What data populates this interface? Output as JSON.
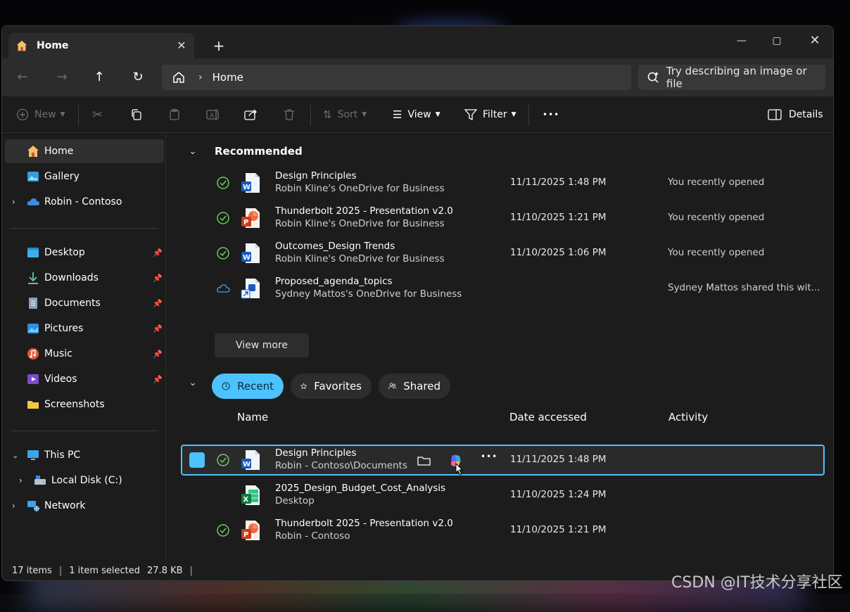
{
  "window": {
    "tab_title": "Home",
    "new_tab_label": "+"
  },
  "address": {
    "current": "Home",
    "search_placeholder": "Try describing an image or file"
  },
  "toolbar": {
    "new_label": "New",
    "sort_label": "Sort",
    "view_label": "View",
    "filter_label": "Filter",
    "more_label": "•••",
    "details_label": "Details"
  },
  "sidebar": {
    "home": "Home",
    "gallery": "Gallery",
    "cloud": "Robin - Contoso",
    "desktop": "Desktop",
    "downloads": "Downloads",
    "documents": "Documents",
    "pictures": "Pictures",
    "music": "Music",
    "videos": "Videos",
    "screenshots": "Screenshots",
    "this_pc": "This PC",
    "local_disk": "Local Disk (C:)",
    "network": "Network"
  },
  "recommended": {
    "title": "Recommended",
    "view_more": "View more",
    "items": [
      {
        "name": "Design Principles",
        "location": "Robin Kline's OneDrive for Business",
        "date": "11/11/2025 1:48 PM",
        "activity": "You recently opened",
        "app": "word"
      },
      {
        "name": "Thunderbolt 2025 - Presentation v2.0",
        "location": "Robin Kline's OneDrive for Business",
        "date": "11/10/2025 1:21 PM",
        "activity": "You recently opened",
        "app": "powerpoint"
      },
      {
        "name": "Outcomes_Design Trends",
        "location": "Robin Kline's OneDrive for Business",
        "date": "11/10/2025 1:06 PM",
        "activity": "You recently opened",
        "app": "word"
      },
      {
        "name": "Proposed_agenda_topics",
        "location": "Sydney Mattos's OneDrive for Business",
        "date": "",
        "activity": "Sydney Mattos shared this wit...",
        "app": "shared-word"
      }
    ]
  },
  "filters": {
    "recent": "Recent",
    "favorites": "Favorites",
    "shared": "Shared"
  },
  "columns": {
    "name": "Name",
    "date": "Date accessed",
    "activity": "Activity"
  },
  "recent": {
    "items": [
      {
        "name": "Design Principles",
        "location": "Robin - Contoso\\Documents",
        "date": "11/11/2025 1:48 PM",
        "app": "word"
      },
      {
        "name": "2025_Design_Budget_Cost_Analysis",
        "location": "Desktop",
        "date": "11/10/2025 1:24 PM",
        "app": "excel"
      },
      {
        "name": "Thunderbolt 2025 - Presentation v2.0",
        "location": "Robin - Contoso",
        "date": "11/10/2025 1:21 PM",
        "app": "powerpoint"
      }
    ]
  },
  "status": {
    "count": "17 items",
    "selection": "1 item selected",
    "size": "27.8 KB"
  },
  "watermark": "CSDN @IT技术分享社区",
  "colors": {
    "accent": "#4cc2ff",
    "synced_green": "#6ccb5f",
    "word_blue": "#185abd",
    "ppt_red": "#c43e1c",
    "excel_green": "#107c41"
  }
}
